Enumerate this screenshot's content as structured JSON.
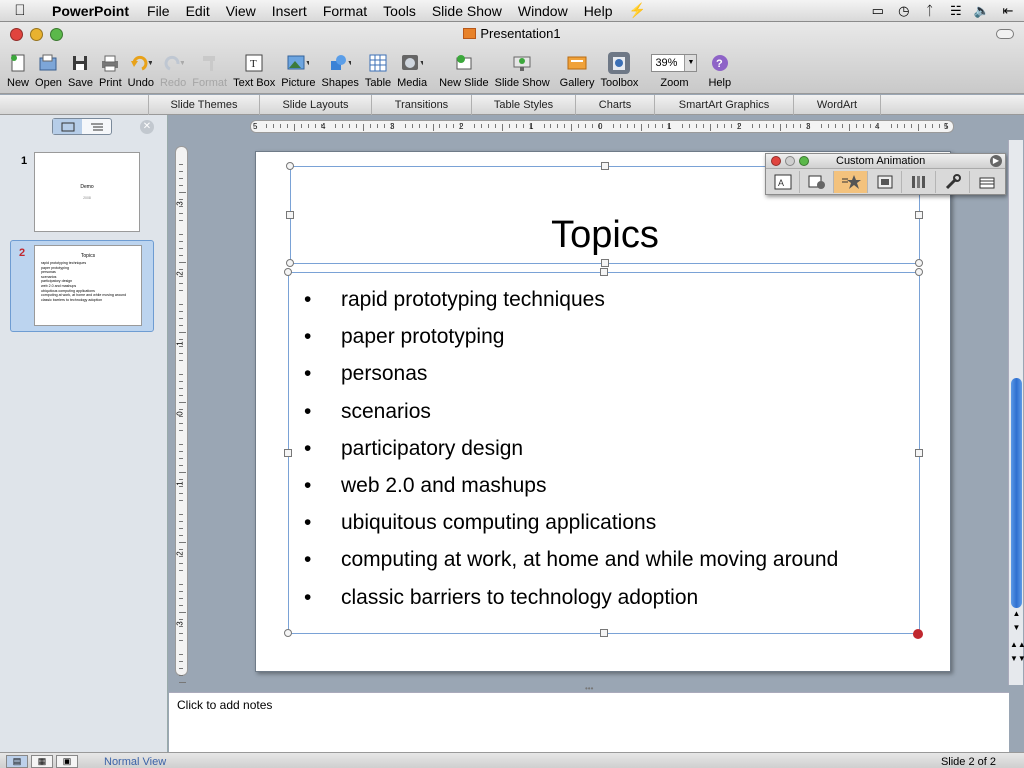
{
  "menubar": {
    "app_name": "PowerPoint",
    "items": [
      "File",
      "Edit",
      "View",
      "Insert",
      "Format",
      "Tools",
      "Slide Show",
      "Window",
      "Help"
    ]
  },
  "window": {
    "title": "Presentation1"
  },
  "toolbar": {
    "new": "New",
    "open": "Open",
    "save": "Save",
    "print": "Print",
    "undo": "Undo",
    "redo": "Redo",
    "format": "Format",
    "text_box": "Text Box",
    "picture": "Picture",
    "shapes": "Shapes",
    "table": "Table",
    "media": "Media",
    "new_slide": "New Slide",
    "slide_show": "Slide Show",
    "gallery": "Gallery",
    "toolbox": "Toolbox",
    "zoom": "Zoom",
    "zoom_value": "39%",
    "help": "Help"
  },
  "ribbon": {
    "tabs": [
      "Slide Themes",
      "Slide Layouts",
      "Transitions",
      "Table Styles",
      "Charts",
      "SmartArt Graphics",
      "WordArt"
    ]
  },
  "slide_pane": {
    "slides": [
      {
        "number": "1",
        "title": "Demo",
        "subtitle": "2008"
      },
      {
        "number": "2",
        "title": "Topics"
      }
    ]
  },
  "ruler": {
    "h_labels": [
      "5",
      "4",
      "3",
      "2",
      "1",
      "0",
      "1",
      "2",
      "3",
      "4",
      "5"
    ],
    "v_labels": [
      "3",
      "2",
      "1",
      "0",
      "1",
      "2",
      "3"
    ]
  },
  "slide": {
    "title": "Topics",
    "bullets": [
      "rapid prototyping techniques",
      "paper prototyping",
      "personas",
      "scenarios",
      "participatory design",
      "web 2.0 and mashups",
      "ubiquitous computing applications",
      "computing at work, at home and while moving around",
      "classic barriers to technology adoption"
    ]
  },
  "custom_animation": {
    "title": "Custom Animation"
  },
  "notes": {
    "placeholder": "Click to add notes"
  },
  "status": {
    "view": "Normal View",
    "slide_count": "Slide 2 of 2"
  },
  "colors": {
    "selection_border": "#7aa2d6",
    "thumb_selected": "#bcd4ef",
    "scroll_thumb": "#2f6fd0",
    "close_light": "#e0443e",
    "minimize_light": "#e8b22f",
    "zoom_light": "#5bb84a"
  }
}
